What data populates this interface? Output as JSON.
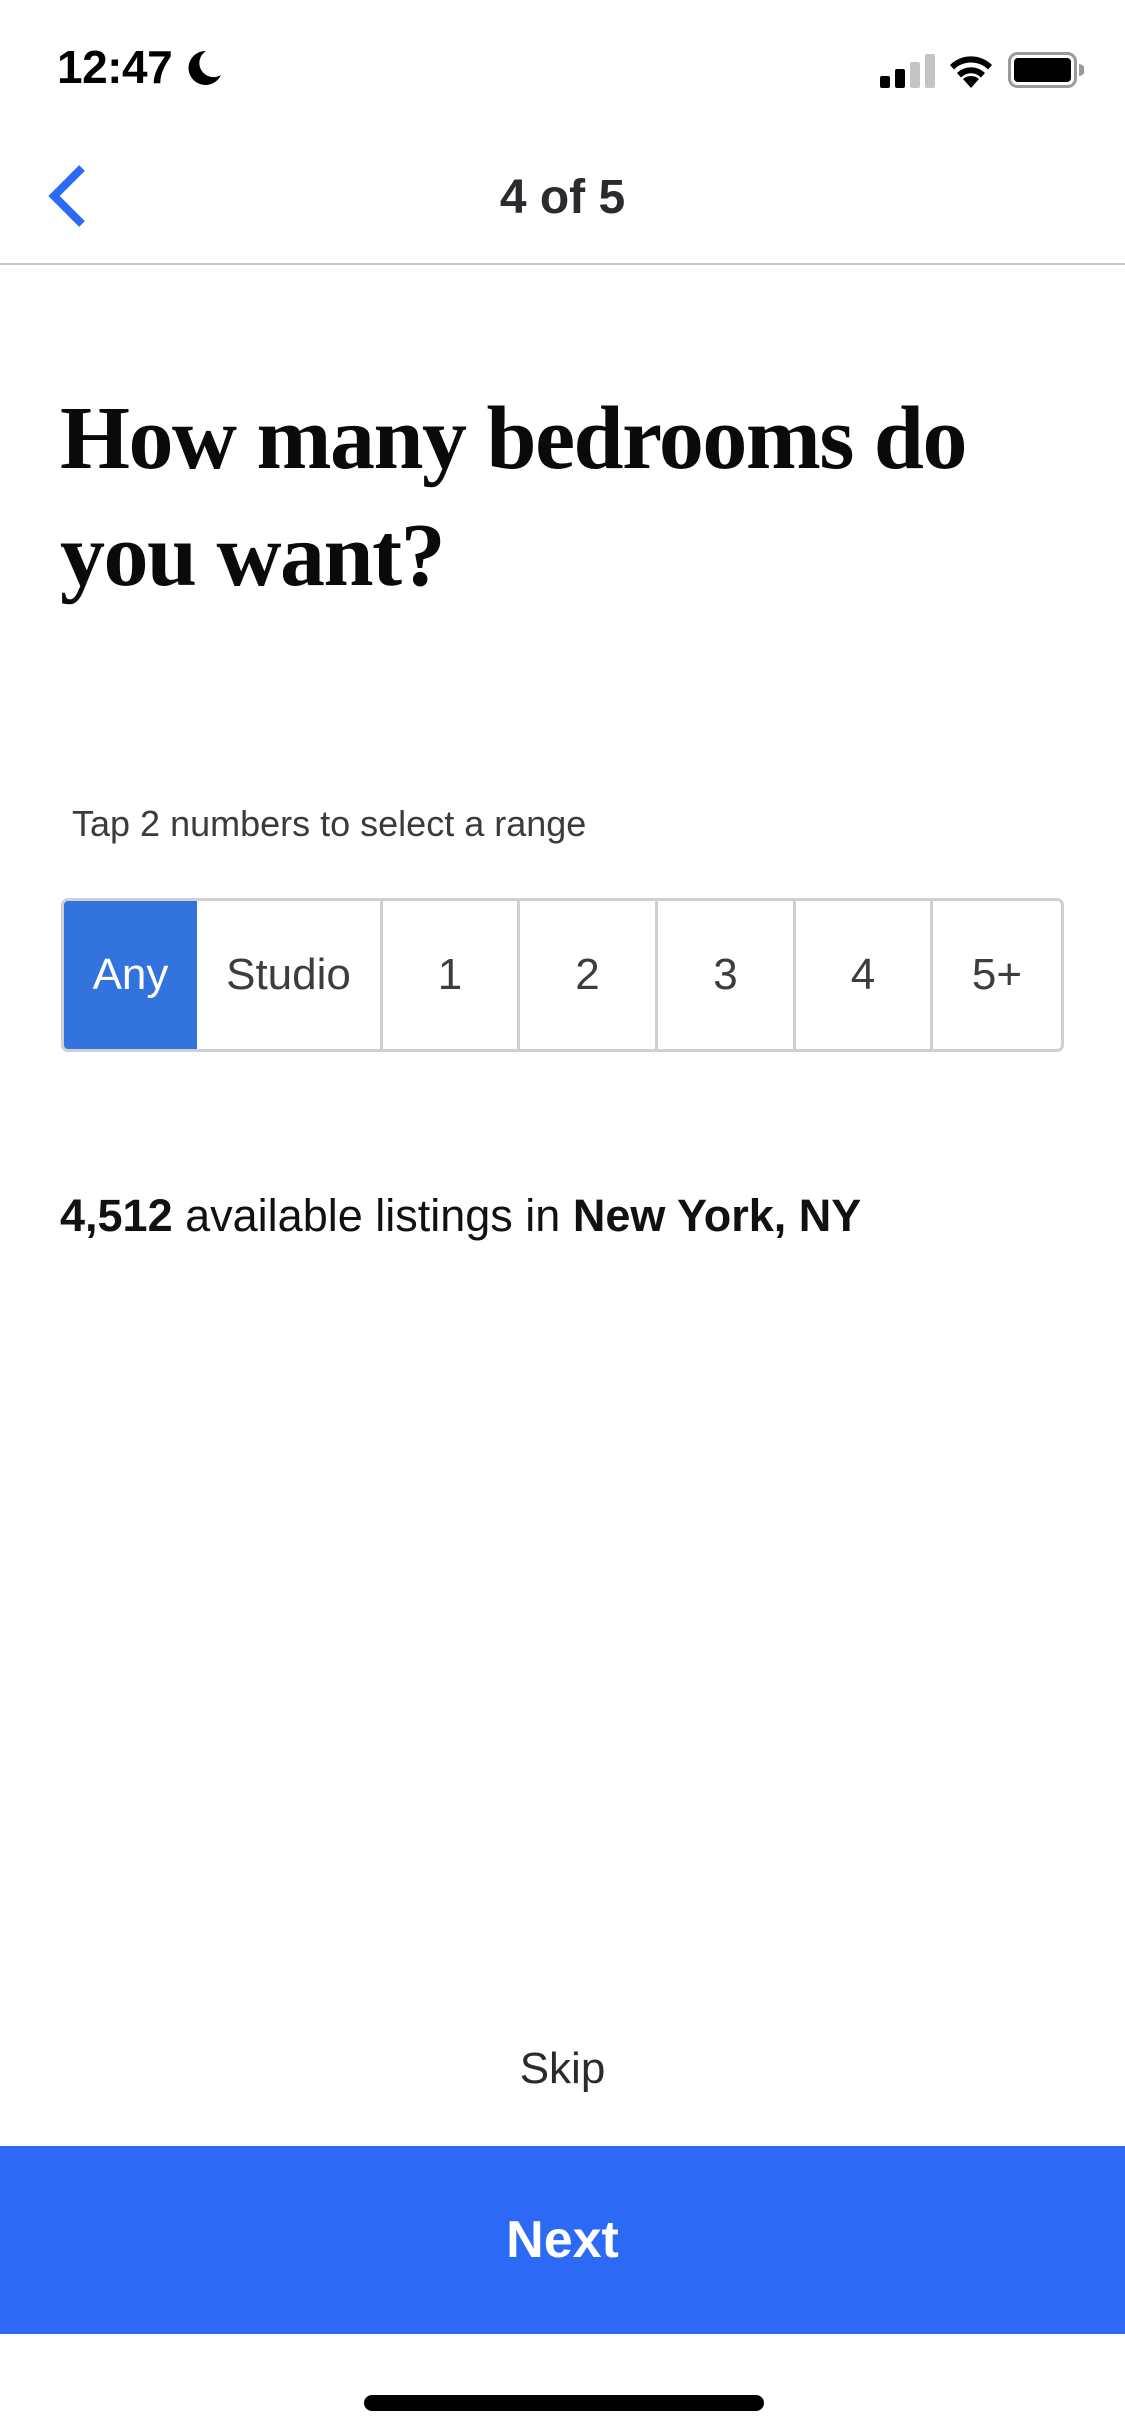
{
  "status_bar": {
    "time": "12:47",
    "focus_mode_icon": "moon-icon",
    "signal_bars_active": 2,
    "signal_bars_total": 4,
    "wifi_icon": "wifi-icon",
    "battery_icon": "battery-icon"
  },
  "nav": {
    "back_icon": "chevron-left-icon",
    "step_label": "4 of 5"
  },
  "question": {
    "title": "How many bedrooms do you want?"
  },
  "bedrooms": {
    "helper_text": "Tap 2 numbers to select a range",
    "options": [
      {
        "label": "Any",
        "selected": true
      },
      {
        "label": "Studio",
        "selected": false
      },
      {
        "label": "1",
        "selected": false
      },
      {
        "label": "2",
        "selected": false
      },
      {
        "label": "3",
        "selected": false
      },
      {
        "label": "4",
        "selected": false
      },
      {
        "label": "5+",
        "selected": false
      }
    ]
  },
  "listings": {
    "count": "4,512",
    "middle_text": " available listings in ",
    "location": "New York, NY"
  },
  "footer": {
    "skip_label": "Skip",
    "next_label": "Next"
  },
  "colors": {
    "accent": "#2c6af6",
    "selected_option": "#3373de",
    "border": "#d0d0d0",
    "divider": "#c8c8cc"
  }
}
